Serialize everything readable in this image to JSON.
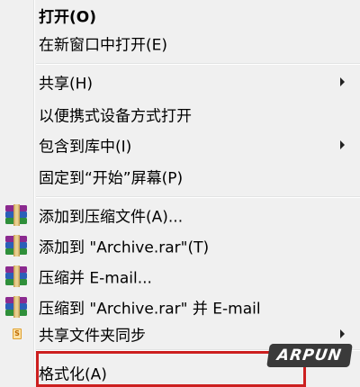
{
  "menu": {
    "items": [
      {
        "label": "打开(O)"
      },
      {
        "label": "在新窗口中打开(E)"
      },
      {
        "label": "共享(H)"
      },
      {
        "label": "以便携式设备方式打开"
      },
      {
        "label": "包含到库中(I)"
      },
      {
        "label": "固定到“开始”屏幕(P)"
      },
      {
        "label": "添加到压缩文件(A)..."
      },
      {
        "label": "添加到 \"Archive.rar\"(T)"
      },
      {
        "label": "压缩并 E-mail..."
      },
      {
        "label": "压缩到 \"Archive.rar\" 并 E-mail"
      },
      {
        "label": "共享文件夹同步"
      },
      {
        "label": "格式化(A)"
      }
    ],
    "icons": {
      "rar": "winrar-archive-icon",
      "sync": "shared-folder-sync-icon",
      "sync_glyph": "S"
    }
  },
  "watermark": {
    "text": "ARPUN"
  },
  "colors": {
    "background": "#f0f0f0",
    "highlight_border": "#cc1f1f",
    "separator": "#e2e3e3"
  }
}
